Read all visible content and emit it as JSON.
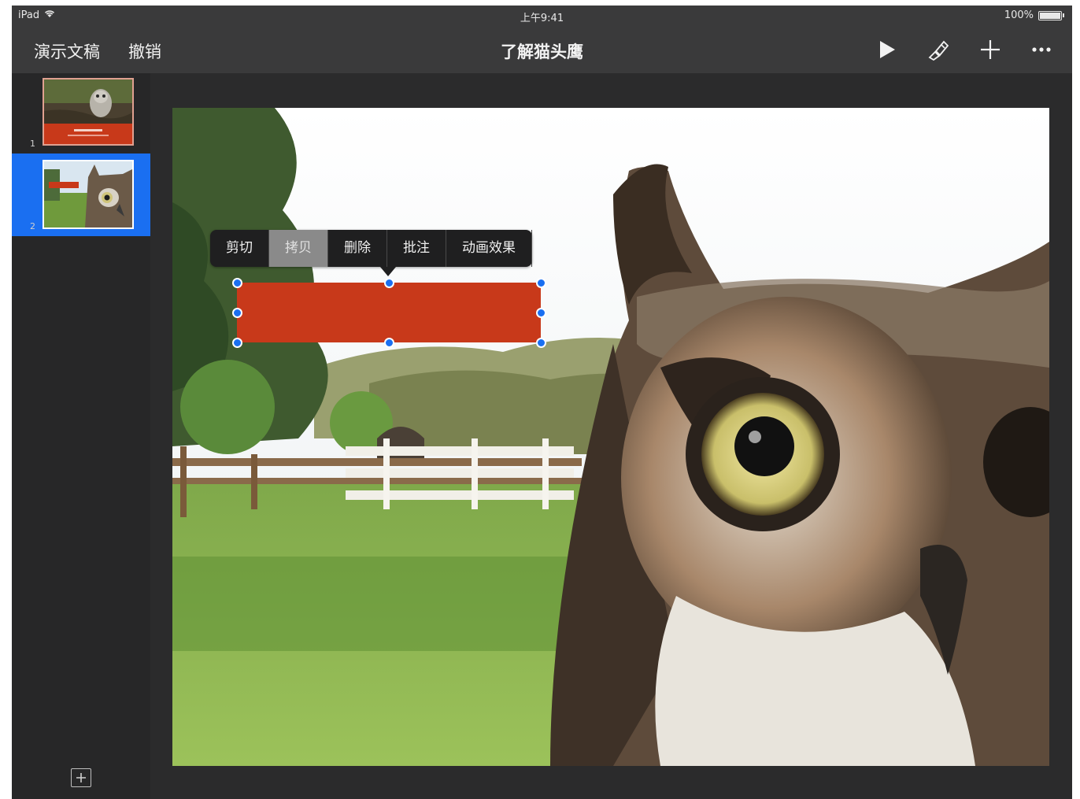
{
  "status_bar": {
    "device": "iPad",
    "time": "上午9:41",
    "battery": "100%"
  },
  "toolbar": {
    "back_label": "演示文稿",
    "undo_label": "撤销",
    "title": "了解猫头鹰",
    "icons": [
      "play-icon",
      "format-brush-icon",
      "add-icon",
      "more-icon"
    ]
  },
  "sidebar": {
    "slides": [
      {
        "number": "1",
        "selected": false
      },
      {
        "number": "2",
        "selected": true
      }
    ]
  },
  "menu": {
    "items": [
      "剪切",
      "拷贝",
      "删除",
      "批注",
      "动画效果"
    ],
    "highlighted": "拷贝"
  },
  "colors": {
    "accent": "#1a6ff1",
    "shape_fill": "#c8391a",
    "toolbar": "#3a3a3b",
    "canvas_bg": "#2b2b2c"
  }
}
